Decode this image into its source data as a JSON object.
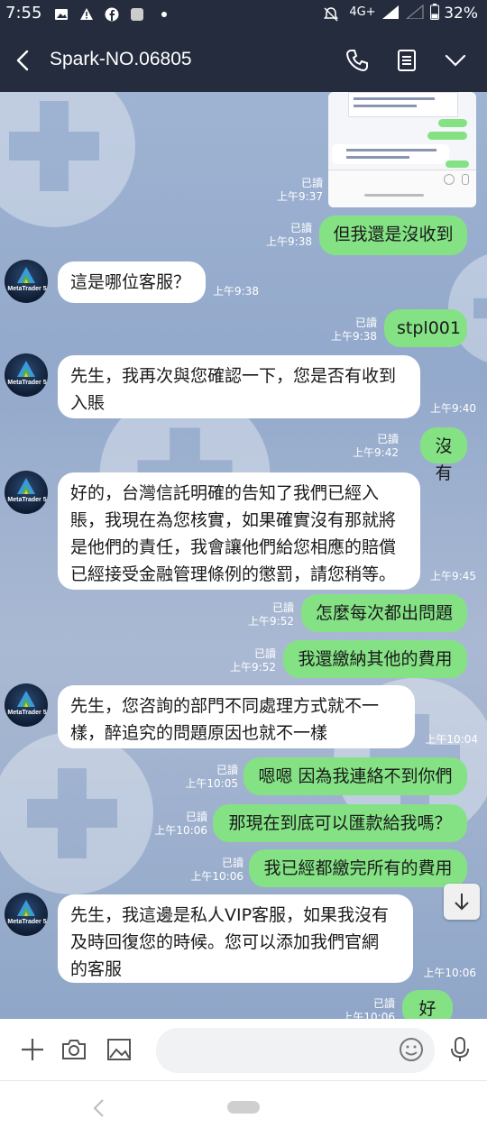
{
  "status_bar": {
    "time": "7:55",
    "network": "4G+",
    "battery": "32%"
  },
  "header": {
    "title": "Spark-NO.06805"
  },
  "avatar_text": "MetaTrader 5",
  "messages": [
    {
      "type": "out",
      "text": "但我還是沒收到",
      "read": "已讀",
      "time": "上午9:38"
    },
    {
      "type": "in",
      "text": "這是哪位客服？",
      "time": "上午9:38"
    },
    {
      "type": "out",
      "text": "stpl001",
      "read": "已讀",
      "time": "上午9:38"
    },
    {
      "type": "in",
      "lines": [
        "先生，我再次與您確認一下，您是否有收到",
        "入賬"
      ],
      "time": "上午9:40"
    },
    {
      "type": "out",
      "text": "沒有",
      "read": "已讀",
      "time": "上午9:42"
    },
    {
      "type": "in",
      "lines": [
        "好的，台灣信託明確的告知了我們已經入",
        "賬，我現在為您核實，如果確實沒有那就將",
        "是他們的責任，我會讓他們給您相應的賠償",
        "已經接受金融管理條例的懲罰，請您稍等。"
      ],
      "time": "上午9:45"
    },
    {
      "type": "out",
      "text": "怎麼每次都出問題",
      "read": "已讀",
      "time": "上午9:52"
    },
    {
      "type": "out",
      "text": "我還繳納其他的費用",
      "read": "已讀",
      "time": "上午9:52"
    },
    {
      "type": "in",
      "lines": [
        "先生，您咨詢的部門不同處理方式就不一",
        "樣，醉追究的問題原因也就不一樣"
      ],
      "time": "上午10:04"
    },
    {
      "type": "out",
      "text": "嗯嗯 因為我連絡不到你們",
      "read": "已讀",
      "time": "上午10:05"
    },
    {
      "type": "out",
      "text": "那現在到底可以匯款給我嗎？",
      "read": "已讀",
      "time": "上午10:06"
    },
    {
      "type": "out",
      "text": "我已經都繳完所有的費用",
      "read": "已讀",
      "time": "上午10:06"
    },
    {
      "type": "in",
      "lines": [
        "先生，我這邊是私人VIP客服，如果我沒有",
        "及時回復您的時候。您可以添加我們官網",
        "的客服"
      ],
      "time": "上午10:06"
    },
    {
      "type": "out",
      "text": "好的",
      "read": "已讀",
      "time": "上午10:06"
    }
  ],
  "image_message": {
    "read": "已讀",
    "time": "上午9:37"
  },
  "icons": {
    "back": "chevron-left-icon",
    "call": "phone-icon",
    "notes": "notes-icon",
    "menu": "chevron-down-icon",
    "plus": "plus-icon",
    "camera": "camera-icon",
    "gallery": "image-icon",
    "emoji": "emoji-icon",
    "mic": "microphone-icon",
    "scroll": "arrow-down-icon"
  },
  "colors": {
    "header_bg": "#242c3e",
    "outgoing_bubble": "#84e285",
    "incoming_bubble": "#ffffff"
  }
}
